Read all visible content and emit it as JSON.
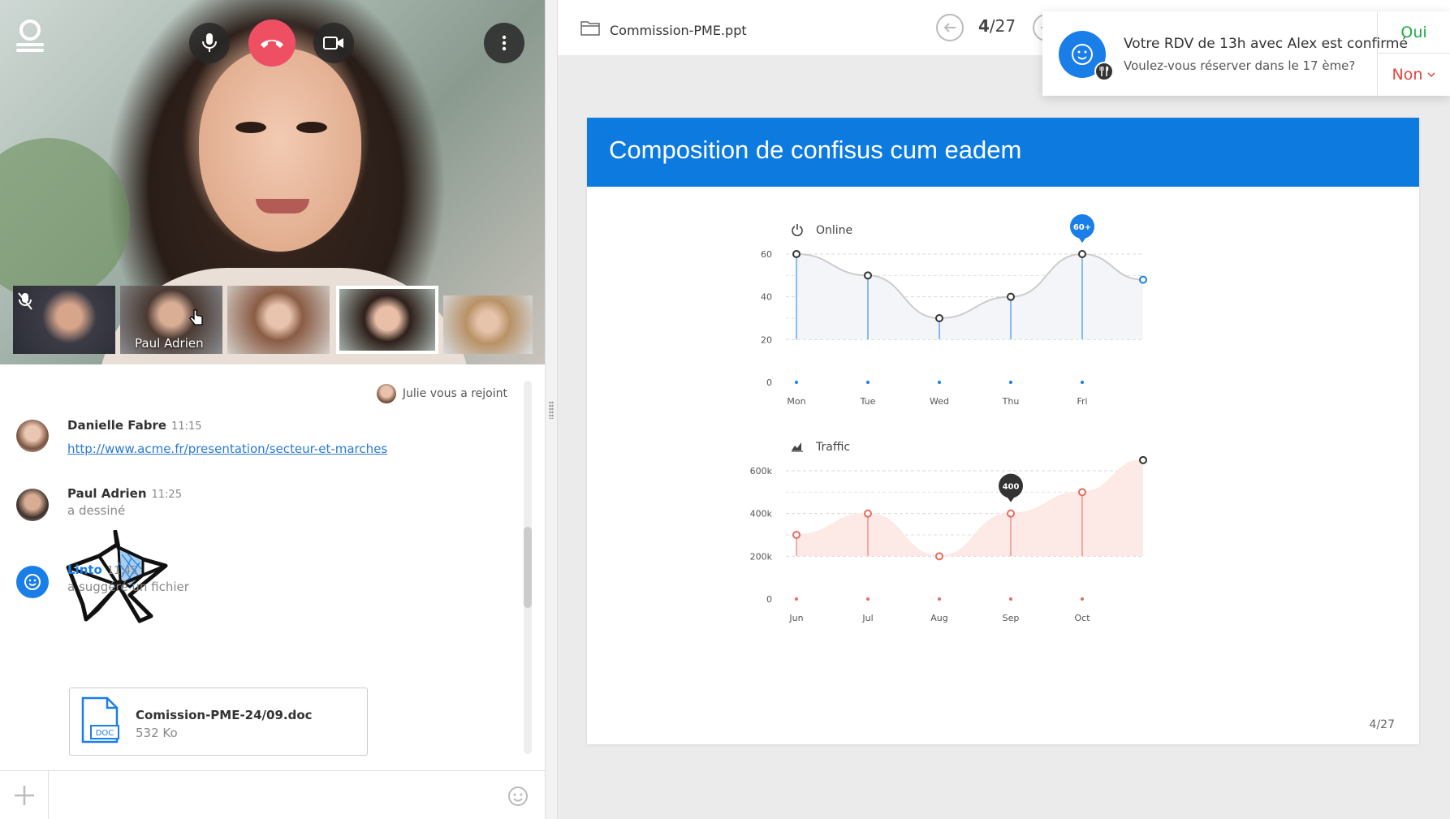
{
  "call": {
    "thumbnails": [
      {
        "name": "",
        "muted": true
      },
      {
        "name": "Paul Adrien",
        "muted": false
      },
      {
        "name": "",
        "muted": false
      },
      {
        "name": "",
        "muted": false,
        "selected": true
      },
      {
        "name": "",
        "muted": false
      }
    ]
  },
  "chat": {
    "join_note": "Julie vous a rejoint",
    "messages": [
      {
        "author": "Danielle Fabre",
        "time": "11:15",
        "link": "http://www.acme.fr/presentation/secteur-et-marches"
      },
      {
        "author": "Paul Adrien",
        "time": "11:25",
        "sub": "a dessiné"
      },
      {
        "author": "Linto",
        "time": "11:45",
        "sub": "a suggéré un fichier"
      }
    ],
    "file": {
      "name": "Comission-PME-24/09.doc",
      "size": "532 Ko",
      "icon_label": "DOC"
    },
    "composer_placeholder": ""
  },
  "doc": {
    "filename": "Commission-PME.ppt",
    "page_current": "4",
    "page_total": "/27"
  },
  "notification": {
    "title": "Votre RDV de 13h avec Alex est confirmé",
    "subtitle": "Voulez-vous réserver dans le 17 ème?",
    "yes_label": "Oui",
    "no_label": "Non"
  },
  "slide": {
    "title": "Composition de confisus cum eadem",
    "page_label": "4/27"
  },
  "colors": {
    "accent": "#0d7ae0",
    "hangup": "#ee4f63",
    "yes": "#22a844",
    "no": "#e2453c",
    "traffic": "#e86a5a"
  },
  "chart_data": [
    {
      "type": "line",
      "title": "Online",
      "categories": [
        "Mon",
        "Tue",
        "Wed",
        "Thu",
        "Fri"
      ],
      "x_ticks": [
        "Mon",
        "Tue",
        "Wed",
        "Thu",
        "Fri"
      ],
      "y_ticks": [
        "0",
        "20",
        "40",
        "60"
      ],
      "values": [
        60,
        50,
        30,
        40,
        60,
        48
      ],
      "ylim": [
        0,
        60
      ],
      "highlight": {
        "index": 4,
        "label": "60+"
      }
    },
    {
      "type": "area",
      "title": "Traffic",
      "categories": [
        "Jun",
        "Jul",
        "Aug",
        "Sep",
        "Oct"
      ],
      "x_ticks": [
        "Jun",
        "Jul",
        "Aug",
        "Sep",
        "Oct"
      ],
      "y_ticks": [
        "0",
        "200k",
        "400k",
        "600k"
      ],
      "values": [
        300,
        400,
        200,
        400,
        500,
        650
      ],
      "unit": "k",
      "ylim": [
        0,
        600
      ],
      "highlight": {
        "index": 3,
        "label": "400"
      }
    }
  ]
}
